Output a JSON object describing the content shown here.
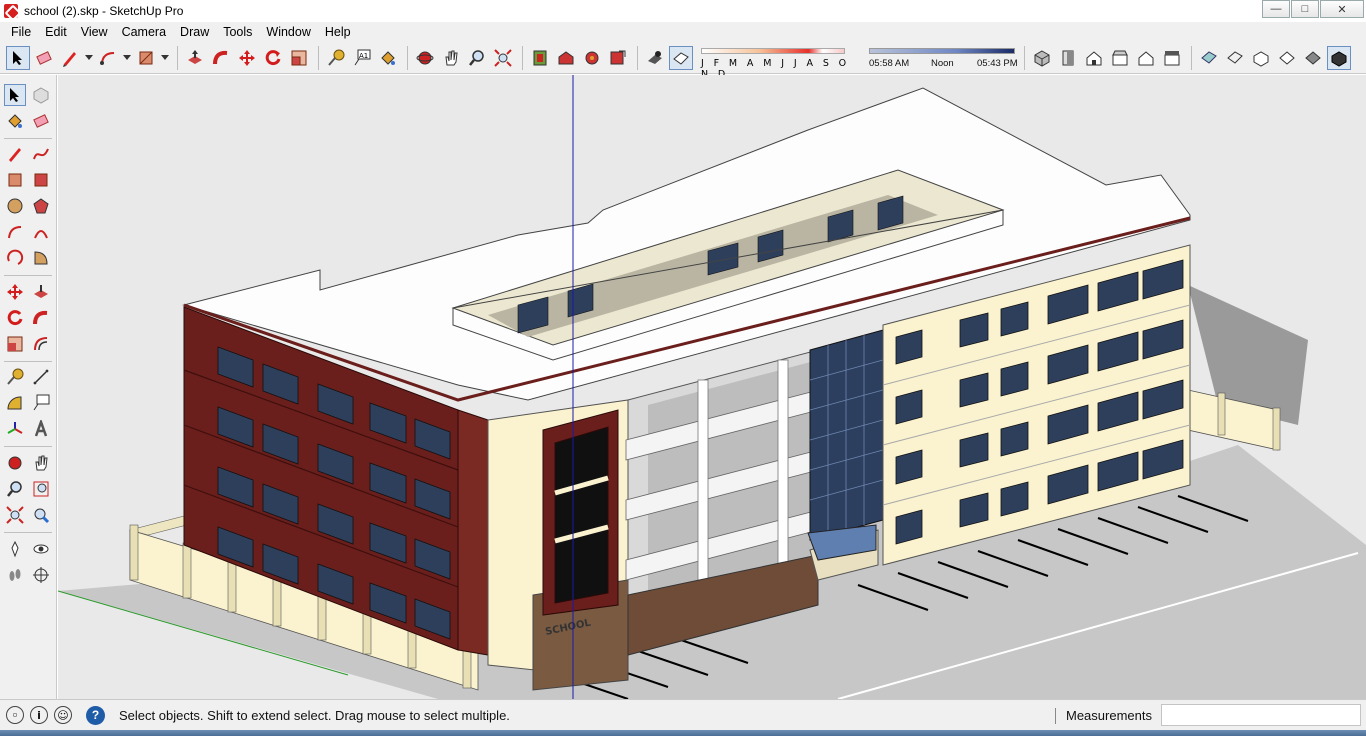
{
  "window": {
    "title": "school (2).skp - SketchUp Pro",
    "controls": {
      "minimize": "—",
      "maximize": "□",
      "close": "✕"
    }
  },
  "menu": [
    "File",
    "Edit",
    "View",
    "Camera",
    "Draw",
    "Tools",
    "Window",
    "Help"
  ],
  "shadows": {
    "months": "J F M A M J J A S O N D",
    "time_start": "05:58 AM",
    "time_mid": "Noon",
    "time_end": "05:43 PM"
  },
  "viewport": {
    "sign_text": "SCHOOL"
  },
  "status": {
    "message": "Select objects. Shift to extend select. Drag mouse to select multiple.",
    "measurements_label": "Measurements",
    "measurements_value": ""
  },
  "icons": {
    "toolbar": [
      "select-icon",
      "eraser-icon",
      "pencil-icon",
      "arc-icon",
      "rectangle-icon",
      "push-pull-icon",
      "follow-me-icon",
      "move-icon",
      "rotate-icon",
      "scale-icon",
      "tape-measure-icon",
      "text-icon",
      "paint-bucket-icon",
      "orbit-icon",
      "pan-icon",
      "zoom-icon",
      "zoom-extents-icon",
      "components-icon",
      "warehouse-icon",
      "extension-icon",
      "share-icon",
      "shadows-icon",
      "fog-icon",
      "iso-view-icon",
      "top-view-icon",
      "front-view-icon",
      "right-view-icon",
      "back-view-icon",
      "left-view-icon",
      "xray-icon",
      "wireframe-icon",
      "hidden-line-icon",
      "shaded-icon",
      "textured-icon"
    ]
  },
  "colors": {
    "brick": "#6b1f1c",
    "cream": "#fbf3cf",
    "roof": "#fdfdfd",
    "glass": "#2d3f5f",
    "ground": "#c9c9c9",
    "axis_blue": "#1a1aa8",
    "axis_green": "#2a9a2a"
  }
}
